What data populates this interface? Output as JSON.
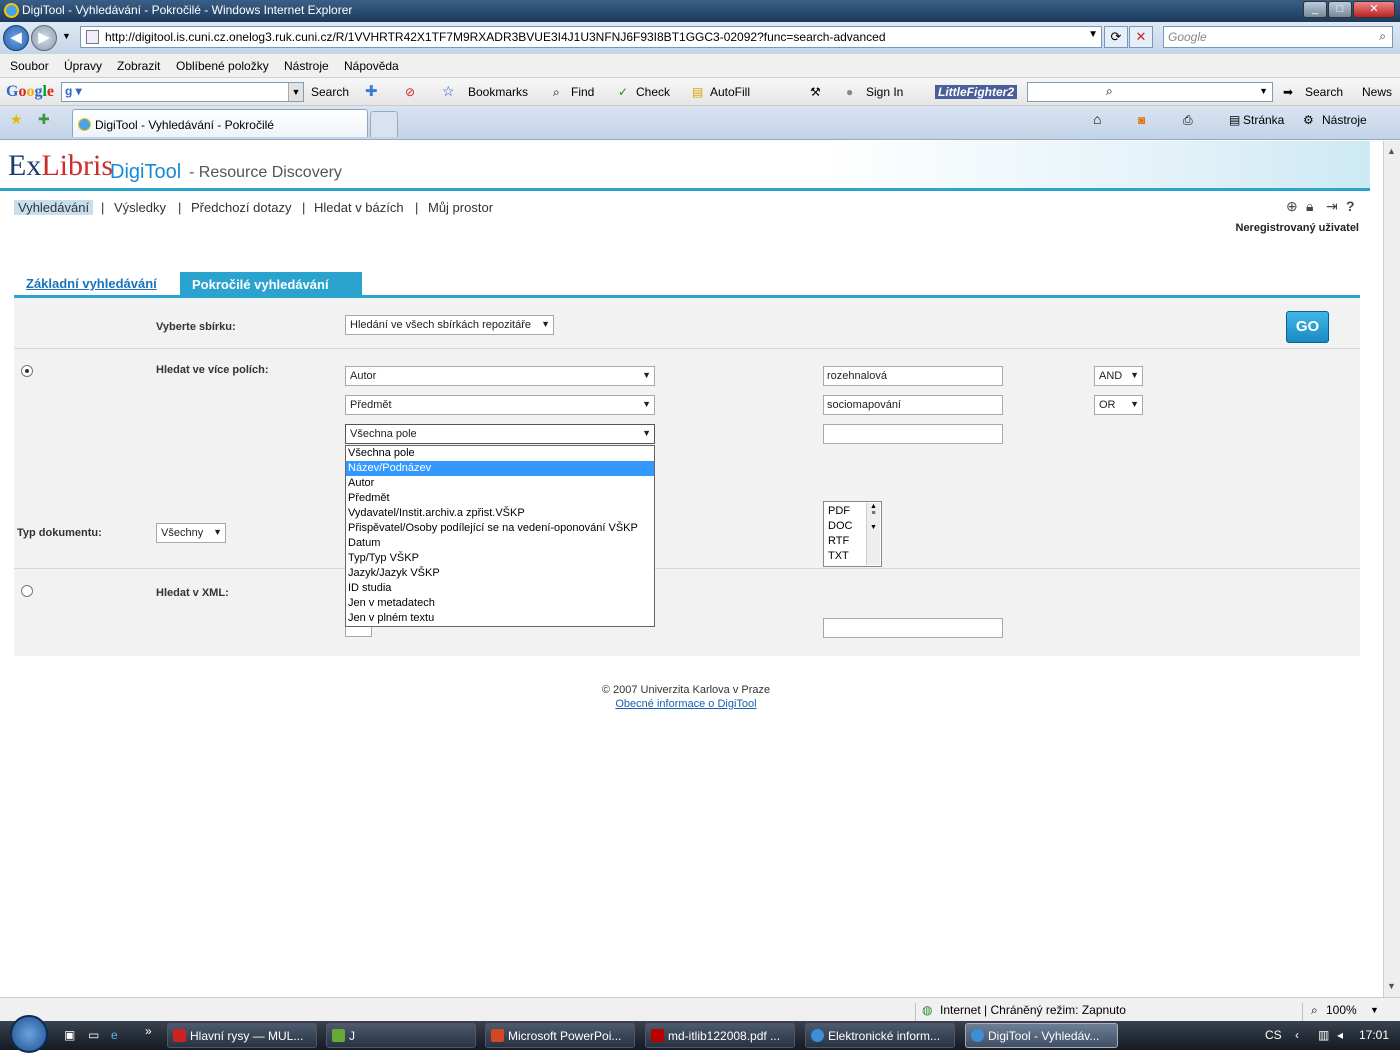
{
  "window": {
    "title": "DigiTool - Vyhledávání - Pokročilé - Windows Internet Explorer",
    "minimize": "_",
    "maximize": "□",
    "close": "✕"
  },
  "address": {
    "url": "http://digitool.is.cuni.cz.onelog3.ruk.cuni.cz/R/1VVHRTR42X1TF7M9RXADR3BVUE3I4J1U3NFNJ6F93I8BT1GGC3-02092?func=search-advanced",
    "search_placeholder": "Google"
  },
  "menu": [
    "Soubor",
    "Úpravy",
    "Zobrazit",
    "Oblíbené položky",
    "Nástroje",
    "Nápověda"
  ],
  "google_toolbar": {
    "logo": "Google",
    "search": "Search",
    "bookmarks": "Bookmarks",
    "find": "Find",
    "check": "Check",
    "autofill": "AutoFill",
    "sign_in": "Sign In",
    "lf_logo": "LittleFighter2",
    "search2": "Search",
    "news": "News"
  },
  "tabbar": {
    "tab_title": "DigiTool - Vyhledávání - Pokročilé",
    "stranka": "Stránka",
    "nastroje": "Nástroje"
  },
  "brand": {
    "ex": "Ex",
    "libris": "Libris",
    "digitool": "DigiTool",
    "subtitle": "- Resource Discovery"
  },
  "nav": {
    "items": [
      "Vyhledávání",
      "Výsledky",
      "Předchozí dotazy",
      "Hledat v bázích",
      "Můj prostor"
    ],
    "sep": "|",
    "user": "Neregistrovaný uživatel"
  },
  "tabs": {
    "basic": "Základní vyhledávání",
    "advanced": "Pokročilé vyhledávání"
  },
  "form": {
    "collection_label": "Vyberte sbírku:",
    "collection_value": "Hledání ve všech sbírkách repozitáře",
    "go": "GO",
    "multi_label": "Hledat ve více polích:",
    "rows": [
      {
        "field": "Autor",
        "value": "rozehnalová",
        "op": "AND"
      },
      {
        "field": "Předmět",
        "value": "sociomapování",
        "op": "OR"
      },
      {
        "field": "Všechna pole",
        "value": ""
      }
    ],
    "dropdown_options": [
      "Všechna pole",
      "Název/Podnázev",
      "Autor",
      "Předmět",
      "Vydavatel/Instit.archiv.a zpřist.VŠKP",
      "Přispěvatel/Osoby podílející se na vedení-oponování VŠKP",
      "Datum",
      "Typ/Typ VŠKP",
      "Jazyk/Jazyk VŠKP",
      "ID studia",
      "Jen v metadatech",
      "Jen v plném textu"
    ],
    "dropdown_highlight": "Název/Podnázev",
    "doctype_label": "Typ dokumentu:",
    "doctype_value": "Všechny",
    "formats": [
      "PDF",
      "DOC",
      "RTF",
      "TXT"
    ],
    "xml_label": "Hledat v XML:"
  },
  "footer": {
    "copyright": "© 2007 Univerzita Karlova v Praze",
    "link": "Obecné informace o DigiTool"
  },
  "status": {
    "zone": "Internet | Chráněný režim: Zapnuto",
    "zoom": "100%"
  },
  "taskbar": {
    "buttons": [
      "Hlavní rysy — MUL...",
      "J",
      "Microsoft PowerPoi...",
      "md-itlib122008.pdf ...",
      "Elektronické inform...",
      "DigiTool - Vyhledáv..."
    ],
    "lang": "CS",
    "time": "17:01"
  },
  "colors": {
    "accent": "#2aa3cf",
    "link": "#1a73b8",
    "highlight": "#3399ff"
  }
}
